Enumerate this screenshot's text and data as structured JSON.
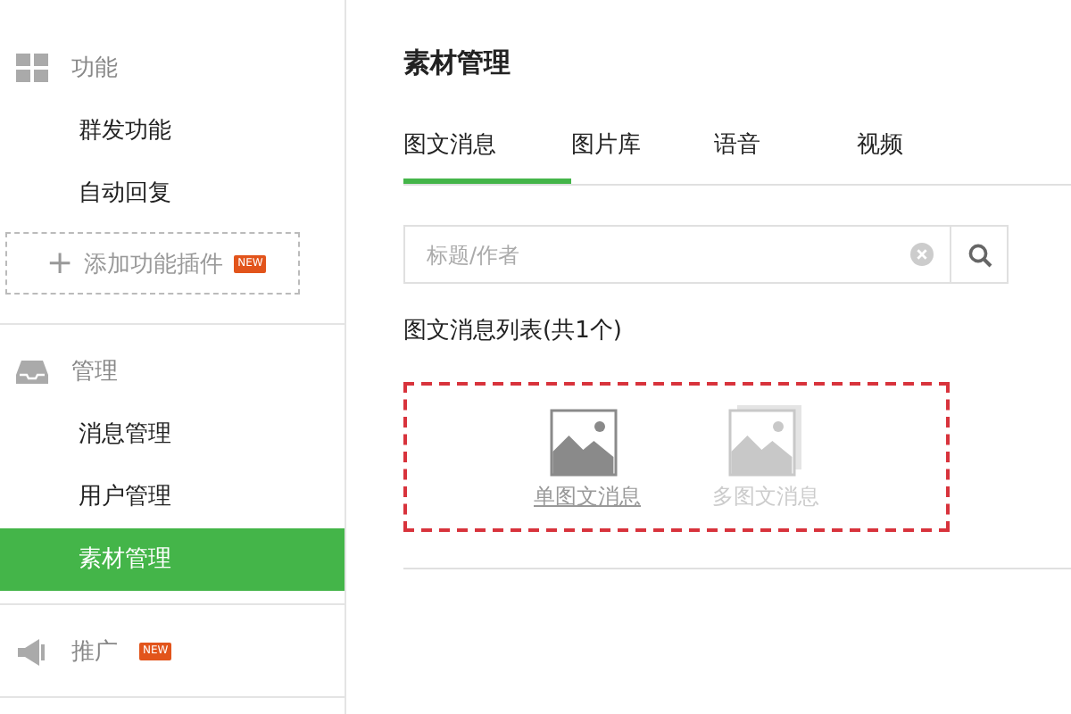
{
  "sidebar": {
    "sections": [
      {
        "kind": "grid",
        "title": "功能",
        "items": [
          {
            "label": "群发功能",
            "selected": false
          },
          {
            "label": "自动回复",
            "selected": false
          }
        ],
        "add_plugin": {
          "label": "添加功能插件",
          "icon": "+",
          "badge": "NEW"
        }
      },
      {
        "kind": "inbox",
        "title": "管理",
        "items": [
          {
            "label": "消息管理",
            "selected": false
          },
          {
            "label": "用户管理",
            "selected": false
          },
          {
            "label": "素材管理",
            "selected": true
          }
        ]
      },
      {
        "kind": "megaphone",
        "title": "推广",
        "badge": "NEW"
      }
    ]
  },
  "main": {
    "title": "素材管理",
    "tabs": [
      {
        "label": "图文消息",
        "selected": true
      },
      {
        "label": "图片库",
        "selected": false
      },
      {
        "label": "语音",
        "selected": false
      },
      {
        "label": "视频",
        "selected": false
      }
    ],
    "search": {
      "placeholder": "标题/作者"
    },
    "list_title": "图文消息列表(共1个)",
    "create_options": [
      {
        "label": "单图文消息",
        "disabled": false
      },
      {
        "label": "多图文消息",
        "disabled": true
      }
    ]
  }
}
